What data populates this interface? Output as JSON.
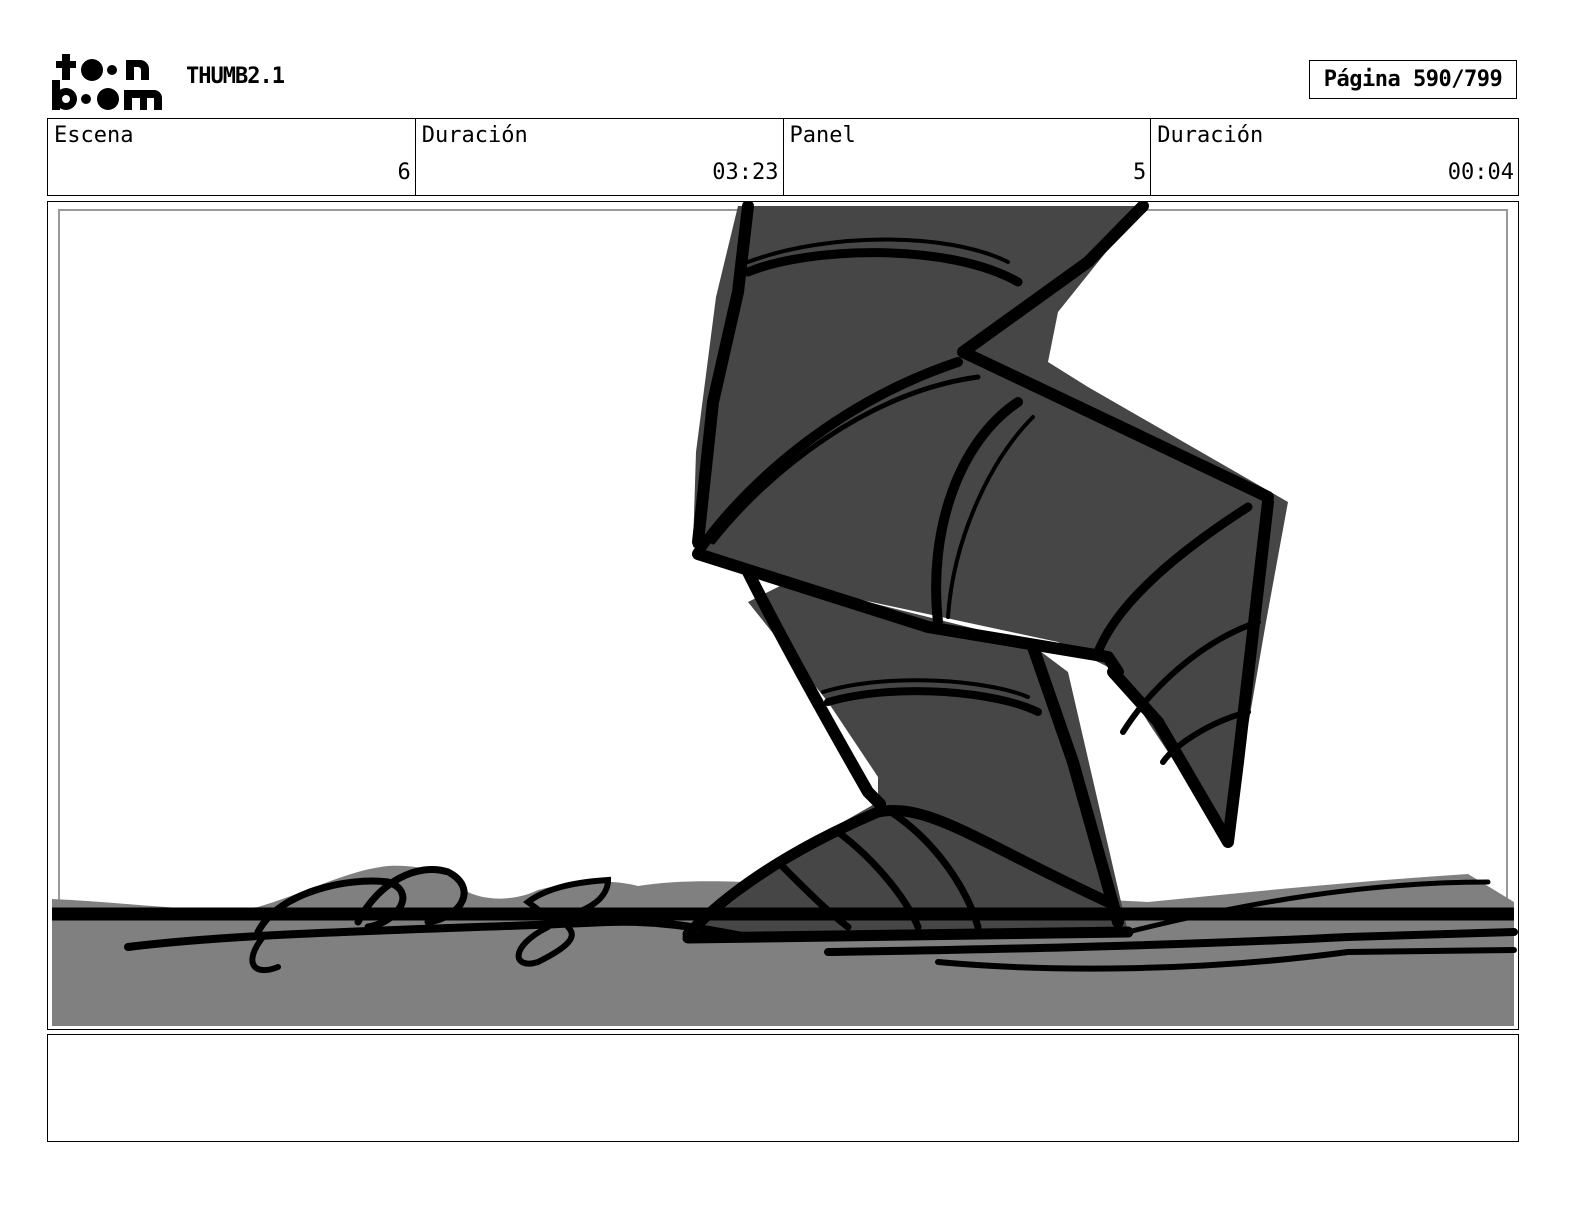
{
  "header": {
    "logo_text_top": "toon",
    "logo_text_bottom": "boom",
    "project": "THUMB2.1",
    "page": "Página 590/799"
  },
  "info": {
    "scene_label": "Escena",
    "scene_value": "6",
    "scene_duration_label": "Duración",
    "scene_duration_value": "03:23",
    "panel_label": "Panel",
    "panel_value": "5",
    "panel_duration_label": "Duración",
    "panel_duration_value": "00:04"
  },
  "panel": {
    "drawing_subject": "sketch-armored-leg-stepping-on-ground"
  },
  "notes": {
    "text": ""
  },
  "colors": {
    "ground": "#808080",
    "armor": "#464646",
    "ink": "#000000"
  }
}
